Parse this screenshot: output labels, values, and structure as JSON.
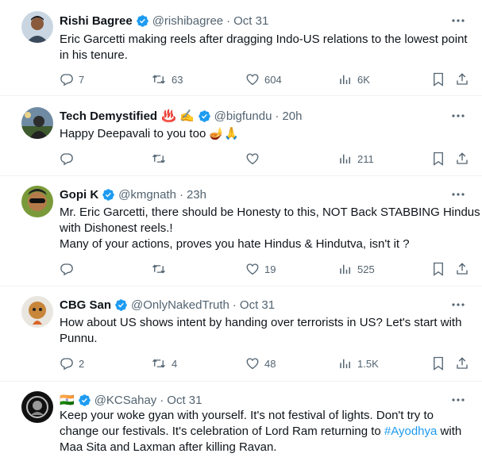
{
  "tweets": [
    {
      "name": "Rishi Bagree",
      "handle": "@rishibagree",
      "time": "Oct 31",
      "lines": [
        "Eric Garcetti making reels after dragging Indo-US relations to the lowest point",
        "in his tenure."
      ],
      "replies": "7",
      "retweets": "63",
      "likes": "604",
      "views": "6K"
    },
    {
      "name": "Tech Demystified",
      "emoji": "♨️ ✍️",
      "handle": "@bigfundu",
      "time": "20h",
      "lines": [
        "Happy Deepavali to you too 🪔🙏"
      ],
      "replies": "",
      "retweets": "",
      "likes": "",
      "views": "211"
    },
    {
      "name": "Gopi K",
      "handle": "@kmgnath",
      "time": "23h",
      "lines": [
        "Mr. Eric Garcetti, there should be Honesty to this, NOT Back STABBING Hindus",
        "with Dishonest reels.!",
        "Many of your actions, proves you hate Hindus & Hindutva, isn't it ?"
      ],
      "replies": "",
      "retweets": "",
      "likes": "19",
      "views": "525"
    },
    {
      "name": "CBG San",
      "handle": "@OnlyNakedTruth",
      "time": "Oct 31",
      "lines": [
        "How about US shows intent by handing over terrorists in US? Let's start with",
        "Punnu."
      ],
      "replies": "2",
      "retweets": "4",
      "likes": "48",
      "views": "1.5K"
    },
    {
      "name": "",
      "flag": "🇮🇳",
      "handle": "@KCSahay",
      "time": "Oct 31",
      "lines": [
        "Keep your woke gyan with yourself. It's not festival of lights. Don't try to",
        "change our festivals. It's celebration of Lord Ram returning  to ",
        "Maa Sita and Laxman after killing Ravan."
      ],
      "hashtag": "#Ayodhya",
      "after_hashtag": " with"
    }
  ],
  "colors": {
    "text": "#0f1419",
    "muted": "#536471",
    "link": "#1d9bf0",
    "verified": "#1d9bf0",
    "divider": "#eff3f4"
  }
}
